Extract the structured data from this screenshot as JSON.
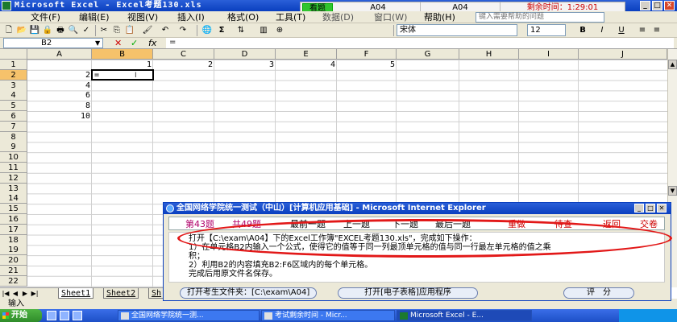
{
  "window": {
    "title": "Microsoft Excel - Excel考题130.xls"
  },
  "exam_bar": {
    "mode_label": "看题",
    "question_a": "A04",
    "question_b": "A04",
    "timer_text": "剩余时间：1:29:01"
  },
  "menu": {
    "items": [
      "文件(F)",
      "编辑(E)",
      "视图(V)",
      "插入(I)",
      "格式(O)",
      "工具(T)",
      "数据(D)",
      "窗口(W)",
      "帮助(H)"
    ],
    "ask_placeholder": "键入需要帮助的问题"
  },
  "toolbar": {
    "font_name": "宋体",
    "font_size": "12",
    "bold": "B",
    "italic": "I",
    "underline": "U",
    "sigma": "Σ"
  },
  "formula_bar": {
    "name_box": "B2",
    "cancel": "✕",
    "confirm": "✓",
    "fx": "fx",
    "content": "="
  },
  "sheet": {
    "columns": [
      "A",
      "B",
      "C",
      "D",
      "E",
      "F",
      "G",
      "H",
      "I",
      "J"
    ],
    "rows": [
      "1",
      "2",
      "3",
      "4",
      "5",
      "6",
      "7",
      "8",
      "9",
      "10",
      "11",
      "12",
      "13",
      "14",
      "15",
      "16",
      "17",
      "18",
      "19",
      "20",
      "21",
      "22"
    ],
    "row1_values": [
      "1",
      "2",
      "3",
      "4",
      "5"
    ],
    "colA_values": [
      "2",
      "4",
      "6",
      "8",
      "10"
    ],
    "active_cell_text": "=",
    "tabs": [
      "Sheet1",
      "Sheet2",
      "Sh"
    ]
  },
  "status": {
    "text": "输入"
  },
  "dialog": {
    "title": "全国网络学院统一测试（中山）[计算机应用基础] - Microsoft Internet Explorer",
    "nav": {
      "question_num": "第43题",
      "total": "共49题",
      "first": "最前一题",
      "prev": "上一题",
      "next": "下一题",
      "last": "最后一题",
      "redo": "重做",
      "pending": "待查",
      "back": "返回",
      "submit": "交卷"
    },
    "lines": [
      "打开【C:\\exam\\A04】下的Excel工作簿\"EXCEL考题130.xls\"，完成如下操作：",
      "1）在单元格B2内输入一个公式，使得它的值等于同一列最顶单元格的值与同一行最左单元格的值之乘",
      "积；",
      "2）利用B2的内容填充B2:F6区域内的每个单元格。",
      "完成后用原文件名保存。"
    ],
    "btn_open_folder": "打开考生文件夹：[C:\\exam\\A04]",
    "btn_open_app": "打开[电子表格]应用程序",
    "btn_score": "评　分"
  },
  "taskbar": {
    "start": "开始",
    "items": [
      "全国网络学院统一测...",
      "考试剩余时间 - Micr...",
      "Microsoft Excel - E..."
    ]
  }
}
